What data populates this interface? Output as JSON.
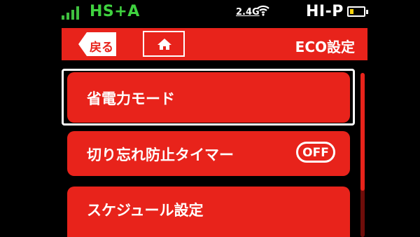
{
  "status": {
    "network": "HS+A",
    "band": "2.4G",
    "mode": "HI-P",
    "signal_icon": "signal-bars-icon",
    "wifi_icon": "wifi-icon",
    "battery_icon": "battery-icon",
    "battery_level": 0.3
  },
  "header": {
    "back_label": "戻る",
    "home_icon": "home-icon",
    "title": "ECO設定"
  },
  "menu": {
    "items": [
      {
        "label": "省電力モード"
      },
      {
        "label": "切り忘れ防止タイマー",
        "toggle": "OFF"
      },
      {
        "label": "スケジュール設定"
      }
    ]
  },
  "colors": {
    "accent": "#e8231b",
    "network_text": "#3fd23f",
    "battery_fill": "#f5d20a",
    "background": "#000000"
  },
  "scroll": {
    "visible_fraction": 0.72
  }
}
